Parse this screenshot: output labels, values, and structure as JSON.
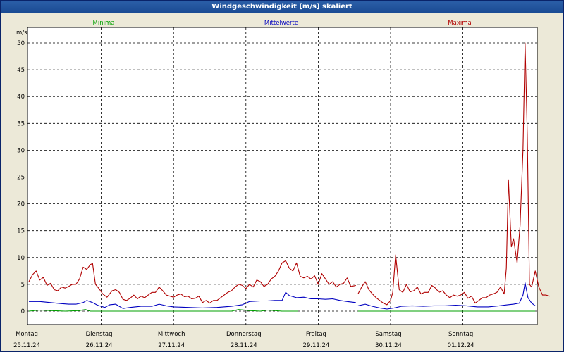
{
  "window": {
    "title": "Windgeschwindigkeit [m/s] skaliert"
  },
  "chart_data": {
    "type": "line",
    "title": "Windgeschwindigkeit [m/s] skaliert",
    "ylabel": "m/s",
    "ylim": [
      0,
      50
    ],
    "xlim": [
      0,
      7
    ],
    "yticks": [
      0,
      5,
      10,
      15,
      20,
      25,
      30,
      35,
      40,
      45,
      50
    ],
    "grid": true,
    "days": [
      {
        "name": "Montag",
        "date": "25.11.24"
      },
      {
        "name": "Dienstag",
        "date": "26.11.24"
      },
      {
        "name": "Mittwoch",
        "date": "27.11.24"
      },
      {
        "name": "Donnerstag",
        "date": "28.11.24"
      },
      {
        "name": "Freitag",
        "date": "29.11.24"
      },
      {
        "name": "Samstag",
        "date": "30.11.24"
      },
      {
        "name": "Sonntag",
        "date": "01.12.24"
      }
    ],
    "series": [
      {
        "name": "Minima",
        "color": "#00a000",
        "segments": [
          [
            [
              0,
              0
            ],
            [
              0.15,
              0.2
            ],
            [
              0.3,
              0.1
            ],
            [
              0.5,
              0
            ],
            [
              0.7,
              0.1
            ],
            [
              0.78,
              0.3
            ],
            [
              0.85,
              0
            ],
            [
              1.2,
              0
            ],
            [
              1.5,
              0
            ],
            [
              2.0,
              0
            ],
            [
              2.5,
              0
            ],
            [
              2.8,
              0
            ],
            [
              2.9,
              0.3
            ],
            [
              3.05,
              0.1
            ],
            [
              3.2,
              0
            ],
            [
              3.3,
              0.2
            ],
            [
              3.5,
              0
            ],
            [
              3.72,
              0
            ]
          ],
          [
            [
              4.55,
              0
            ],
            [
              5.0,
              0
            ],
            [
              5.5,
              0
            ],
            [
              6.0,
              0
            ],
            [
              6.5,
              0
            ],
            [
              7.0,
              0
            ]
          ]
        ]
      },
      {
        "name": "Mittelwerte",
        "color": "#0000c0",
        "segments": [
          [
            [
              0,
              1.8
            ],
            [
              0.15,
              1.8
            ],
            [
              0.3,
              1.6
            ],
            [
              0.45,
              1.4
            ],
            [
              0.55,
              1.3
            ],
            [
              0.65,
              1.3
            ],
            [
              0.75,
              1.6
            ],
            [
              0.8,
              2.0
            ],
            [
              0.88,
              1.6
            ],
            [
              0.95,
              1.1
            ],
            [
              1.05,
              0.7
            ],
            [
              1.12,
              1.2
            ],
            [
              1.2,
              1.3
            ],
            [
              1.3,
              0.5
            ],
            [
              1.4,
              0.7
            ],
            [
              1.55,
              0.9
            ],
            [
              1.7,
              0.9
            ],
            [
              1.8,
              1.3
            ],
            [
              1.9,
              1.0
            ],
            [
              2.0,
              0.8
            ],
            [
              2.2,
              0.7
            ],
            [
              2.4,
              0.6
            ],
            [
              2.6,
              0.7
            ],
            [
              2.8,
              0.9
            ],
            [
              2.95,
              1.2
            ],
            [
              3.05,
              1.8
            ],
            [
              3.2,
              1.9
            ],
            [
              3.3,
              1.9
            ],
            [
              3.4,
              2.0
            ],
            [
              3.5,
              2.0
            ],
            [
              3.55,
              3.5
            ],
            [
              3.6,
              2.9
            ],
            [
              3.7,
              2.5
            ],
            [
              3.8,
              2.6
            ],
            [
              3.9,
              2.3
            ],
            [
              4.0,
              2.3
            ],
            [
              4.1,
              2.2
            ],
            [
              4.2,
              2.3
            ],
            [
              4.3,
              2.0
            ],
            [
              4.4,
              1.8
            ],
            [
              4.52,
              1.6
            ]
          ],
          [
            [
              4.55,
              1.0
            ],
            [
              4.65,
              1.3
            ],
            [
              4.75,
              0.9
            ],
            [
              4.85,
              0.6
            ],
            [
              4.95,
              0.4
            ],
            [
              5.05,
              0.6
            ],
            [
              5.15,
              0.9
            ],
            [
              5.3,
              1.0
            ],
            [
              5.45,
              0.9
            ],
            [
              5.6,
              1.0
            ],
            [
              5.75,
              1.0
            ],
            [
              5.9,
              1.1
            ],
            [
              6.05,
              1.0
            ],
            [
              6.2,
              0.8
            ],
            [
              6.35,
              0.8
            ],
            [
              6.5,
              1.0
            ],
            [
              6.62,
              1.2
            ],
            [
              6.7,
              1.3
            ],
            [
              6.78,
              1.5
            ],
            [
              6.83,
              3.0
            ],
            [
              6.86,
              5.3
            ],
            [
              6.9,
              2.5
            ],
            [
              6.95,
              1.5
            ],
            [
              7.0,
              1.0
            ]
          ]
        ]
      },
      {
        "name": "Maxima",
        "color": "#b00000",
        "segments": [
          [
            [
              0,
              5.5
            ],
            [
              0.05,
              6.8
            ],
            [
              0.1,
              7.5
            ],
            [
              0.15,
              5.8
            ],
            [
              0.2,
              6.3
            ],
            [
              0.25,
              4.8
            ],
            [
              0.3,
              5.2
            ],
            [
              0.35,
              4.0
            ],
            [
              0.4,
              3.8
            ],
            [
              0.45,
              4.5
            ],
            [
              0.5,
              4.3
            ],
            [
              0.55,
              4.6
            ],
            [
              0.6,
              5.0
            ],
            [
              0.65,
              5.0
            ],
            [
              0.7,
              6.0
            ],
            [
              0.75,
              8.2
            ],
            [
              0.8,
              7.8
            ],
            [
              0.85,
              8.7
            ],
            [
              0.88,
              8.9
            ],
            [
              0.92,
              5.0
            ],
            [
              0.97,
              4.2
            ],
            [
              1.02,
              3.2
            ],
            [
              1.08,
              2.6
            ],
            [
              1.15,
              3.8
            ],
            [
              1.2,
              4.0
            ],
            [
              1.25,
              3.5
            ],
            [
              1.3,
              2.2
            ],
            [
              1.35,
              2.0
            ],
            [
              1.4,
              2.4
            ],
            [
              1.45,
              3.0
            ],
            [
              1.5,
              2.3
            ],
            [
              1.55,
              2.8
            ],
            [
              1.6,
              2.5
            ],
            [
              1.65,
              3.0
            ],
            [
              1.7,
              3.5
            ],
            [
              1.75,
              3.5
            ],
            [
              1.8,
              4.5
            ],
            [
              1.85,
              3.8
            ],
            [
              1.9,
              3.0
            ],
            [
              1.95,
              2.8
            ],
            [
              2.0,
              2.6
            ],
            [
              2.05,
              3.0
            ],
            [
              2.1,
              3.2
            ],
            [
              2.15,
              2.7
            ],
            [
              2.2,
              2.8
            ],
            [
              2.25,
              2.3
            ],
            [
              2.3,
              2.4
            ],
            [
              2.35,
              2.8
            ],
            [
              2.4,
              1.6
            ],
            [
              2.45,
              2.0
            ],
            [
              2.5,
              1.5
            ],
            [
              2.55,
              2.0
            ],
            [
              2.6,
              2.0
            ],
            [
              2.65,
              2.5
            ],
            [
              2.7,
              3.0
            ],
            [
              2.75,
              3.5
            ],
            [
              2.8,
              3.8
            ],
            [
              2.85,
              4.5
            ],
            [
              2.9,
              5.0
            ],
            [
              2.95,
              4.8
            ],
            [
              3.0,
              4.2
            ],
            [
              3.05,
              5.0
            ],
            [
              3.1,
              4.5
            ],
            [
              3.15,
              5.8
            ],
            [
              3.2,
              5.5
            ],
            [
              3.25,
              4.6
            ],
            [
              3.3,
              5.0
            ],
            [
              3.35,
              6.0
            ],
            [
              3.4,
              6.5
            ],
            [
              3.45,
              7.5
            ],
            [
              3.5,
              9.0
            ],
            [
              3.55,
              9.4
            ],
            [
              3.6,
              8.0
            ],
            [
              3.65,
              7.5
            ],
            [
              3.7,
              9.0
            ],
            [
              3.75,
              6.5
            ],
            [
              3.8,
              6.2
            ],
            [
              3.85,
              6.5
            ],
            [
              3.9,
              6.0
            ],
            [
              3.95,
              6.6
            ],
            [
              4.0,
              5.0
            ],
            [
              4.05,
              7.0
            ],
            [
              4.1,
              6.0
            ],
            [
              4.15,
              5.0
            ],
            [
              4.2,
              5.5
            ],
            [
              4.25,
              4.5
            ],
            [
              4.3,
              5.0
            ],
            [
              4.35,
              5.2
            ],
            [
              4.4,
              6.2
            ],
            [
              4.45,
              4.6
            ],
            [
              4.52,
              4.8
            ]
          ],
          [
            [
              4.55,
              3.2
            ],
            [
              4.6,
              4.5
            ],
            [
              4.65,
              5.5
            ],
            [
              4.7,
              4.0
            ],
            [
              4.75,
              3.2
            ],
            [
              4.8,
              2.5
            ],
            [
              4.85,
              2.0
            ],
            [
              4.9,
              1.5
            ],
            [
              4.95,
              1.2
            ],
            [
              5.0,
              2.0
            ],
            [
              5.03,
              3.5
            ],
            [
              5.07,
              10.5
            ],
            [
              5.12,
              4.0
            ],
            [
              5.17,
              3.5
            ],
            [
              5.22,
              5.0
            ],
            [
              5.27,
              3.6
            ],
            [
              5.32,
              3.8
            ],
            [
              5.37,
              4.5
            ],
            [
              5.42,
              3.2
            ],
            [
              5.47,
              3.5
            ],
            [
              5.52,
              3.5
            ],
            [
              5.57,
              4.8
            ],
            [
              5.62,
              4.3
            ],
            [
              5.67,
              3.5
            ],
            [
              5.72,
              3.8
            ],
            [
              5.77,
              3.0
            ],
            [
              5.82,
              2.5
            ],
            [
              5.87,
              3.0
            ],
            [
              5.92,
              2.8
            ],
            [
              5.97,
              3.0
            ],
            [
              6.02,
              3.5
            ],
            [
              6.07,
              2.4
            ],
            [
              6.12,
              2.8
            ],
            [
              6.17,
              1.5
            ],
            [
              6.22,
              2.0
            ],
            [
              6.27,
              2.5
            ],
            [
              6.32,
              2.5
            ],
            [
              6.37,
              3.0
            ],
            [
              6.42,
              3.2
            ],
            [
              6.47,
              3.5
            ],
            [
              6.52,
              4.5
            ],
            [
              6.57,
              3.2
            ],
            [
              6.6,
              8.0
            ],
            [
              6.63,
              24.5
            ],
            [
              6.67,
              12.0
            ],
            [
              6.7,
              13.5
            ],
            [
              6.75,
              9.0
            ],
            [
              6.79,
              16.0
            ],
            [
              6.83,
              30.0
            ],
            [
              6.86,
              50.0
            ],
            [
              6.89,
              33.0
            ],
            [
              6.92,
              5.0
            ],
            [
              6.95,
              4.5
            ],
            [
              7.0,
              7.5
            ],
            [
              7.05,
              4.5
            ],
            [
              7.1,
              3.0
            ],
            [
              7.15,
              3.0
            ],
            [
              7.2,
              2.8
            ]
          ]
        ]
      }
    ]
  }
}
